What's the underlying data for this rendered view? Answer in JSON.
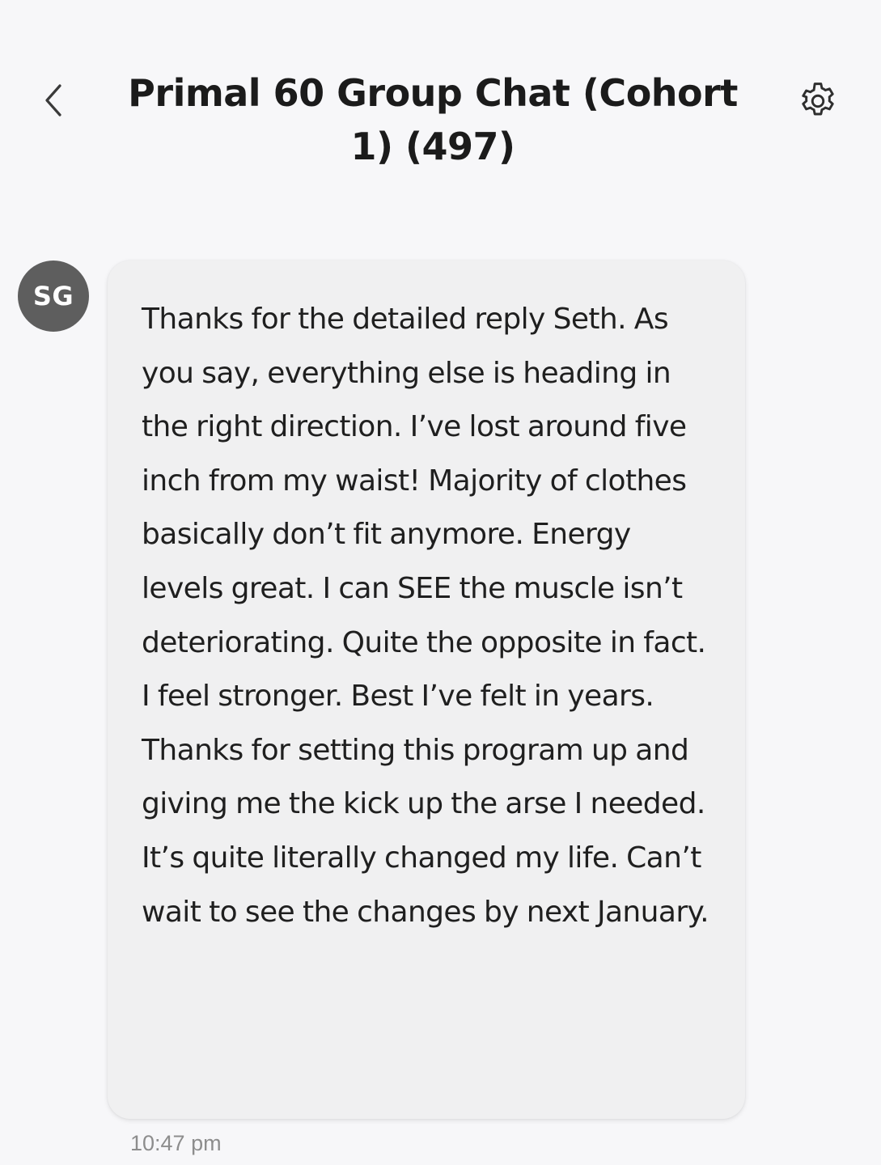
{
  "header": {
    "title": "Primal 60 Group Chat (Cohort 1) (497)",
    "back_icon": "chevron-left-icon",
    "settings_icon": "gear-icon"
  },
  "message": {
    "sender_initials": "SG",
    "text": "Thanks for the detailed reply Seth. As you say, everything else is heading in the right direction. I’ve lost around five inch from my waist! Majority of clothes basically don’t fit anymore. Energy levels great. I can SEE the muscle isn’t deteriorating. Quite the opposite in fact. I feel stronger. Best I’ve felt in years. Thanks for setting this program up and giving me the kick up the arse I needed. It’s quite literally changed my life. Can’t wait to see the changes by next January.",
    "timestamp": "10:47 pm"
  },
  "colors": {
    "background": "#f7f7f9",
    "bubble": "#f0f0f1",
    "avatar": "#5e5e5e",
    "timestamp": "#8d8d8d"
  }
}
